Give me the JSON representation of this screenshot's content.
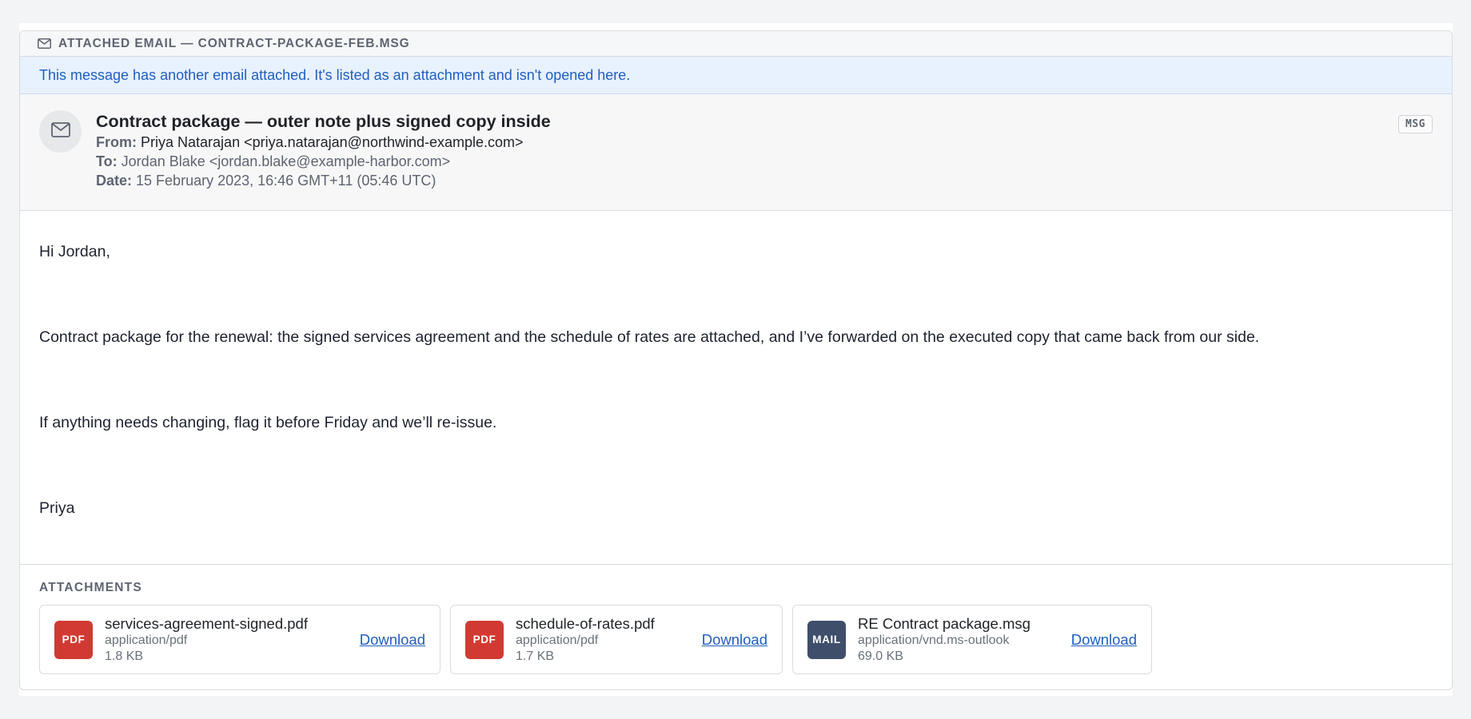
{
  "card": {
    "title": "Attached email — contract-package-feb.msg",
    "icon": "envelope-icon"
  },
  "notice": "This message has another email attached. It's listed as an attachment and isn't opened here.",
  "email": {
    "subject": "Contract package — outer note plus signed copy inside",
    "from_label": "From:",
    "from": "Priya Natarajan <priya.natarajan@northwind-example.com>",
    "to_label": "To:",
    "to": "Jordan Blake <jordan.blake@example-harbor.com>",
    "date_label": "Date:",
    "date": "15 February 2023, 16:46 GMT+11 (05:46 UTC)",
    "badge": "MSG",
    "avatar_icon": "envelope-icon"
  },
  "body": {
    "paragraphs": [
      "Hi Jordan,",
      "Contract package for the renewal: the signed services agreement and the schedule of rates are attached, and I’ve forwarded on the executed copy that came back from our side.",
      "If anything needs changing, flag it before Friday and we’ll re-issue.",
      "Priya"
    ]
  },
  "attachments": {
    "title": "Attachments",
    "items": [
      {
        "icon_label": "PDF",
        "icon_color": "#d13a32",
        "name": "services-agreement-signed.pdf",
        "type": "application/pdf",
        "size": "1.8 KB",
        "action": "Download"
      },
      {
        "icon_label": "PDF",
        "icon_color": "#d13a32",
        "name": "schedule-of-rates.pdf",
        "type": "application/pdf",
        "size": "1.7 KB",
        "action": "Download"
      },
      {
        "icon_label": "MAIL",
        "icon_color": "#3f4e6b",
        "name": "RE Contract package.msg",
        "type": "application/vnd.ms-outlook",
        "size": "69.0 KB",
        "action": "Download"
      }
    ]
  },
  "colors": {
    "link": "#1f5fbf",
    "notice_bg": "#e8f1fe",
    "pdf": "#d13a32",
    "mail": "#3f4e6b"
  }
}
